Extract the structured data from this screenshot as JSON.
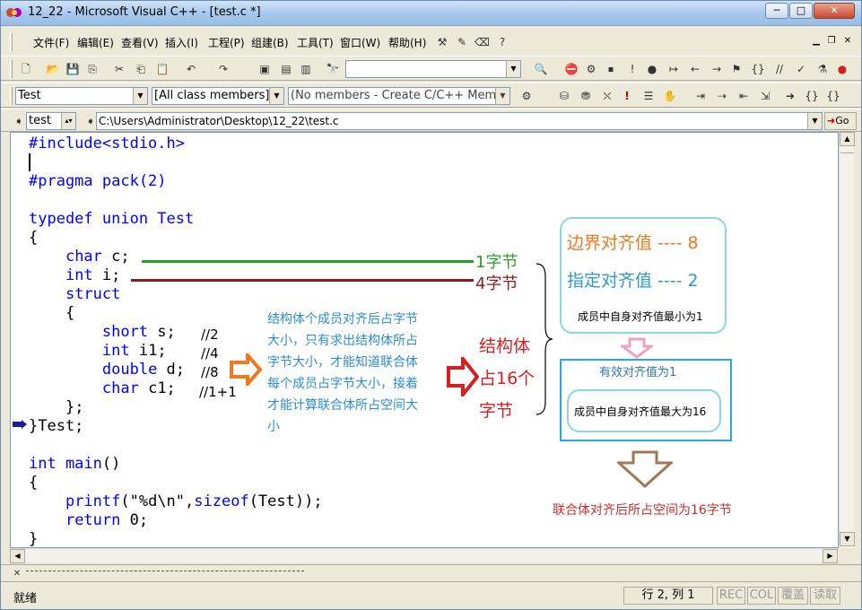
{
  "window": {
    "title": "12_22 - Microsoft Visual C++ - [test.c *]",
    "min": "─",
    "max": "□",
    "close": "✕"
  },
  "menu": [
    "文件(F)",
    "编辑(E)",
    "查看(V)",
    "插入(I)",
    "工程(P)",
    "组建(B)",
    "工具(T)",
    "窗口(W)",
    "帮助(H)"
  ],
  "toolbar_class": {
    "project": "Test",
    "classes": "[All class members]",
    "members": "(No members - Create C/C++ Memb"
  },
  "toolbar_path": {
    "file": "test",
    "path": "C:\\Users\\Administrator\\Desktop\\12_22\\test.c",
    "go": "Go"
  },
  "code": {
    "l1": "#include<stdio.h>",
    "l3": "#pragma pack(2)",
    "l5_kw": "typedef union",
    "l5_name": " Test",
    "l6": "{",
    "l7_kw": "char",
    "l7_rest": " c;",
    "l8_kw": "int",
    "l8_rest": " i;",
    "l9": "struct",
    "l10": "{",
    "l11_kw": "short",
    "l11_rest": " s;",
    "l11_c": "//2",
    "l12_kw": "int",
    "l12_rest": " i1;",
    "l12_c": "//4",
    "l13_kw": "double",
    "l13_rest": " d;",
    "l13_c": "//8",
    "l14_kw": "char",
    "l14_rest": " c1;",
    "l14_c": "//1+1",
    "l15": "};",
    "l16": "}Test;",
    "l18_kw": "int main",
    "l18_rest": "()",
    "l19": "{",
    "l20_kw": "printf",
    "l20_mid": "(\"%d\\n\",",
    "l20_kw2": "sizeof",
    "l20_end": "(Test));",
    "l21_kw": "return",
    "l21_rest": " 0;",
    "l22": "}"
  },
  "annotations": {
    "one_byte": "1字节",
    "four_byte": "4字节",
    "struct_desc": [
      "结构体个成员对齐后占字节",
      "大小，只有求出结构体所占",
      "字节大小，才能知道联合体",
      "每个成员占字节大小，接着",
      "才能计算联合体所占空间大",
      "小"
    ],
    "struct_size": [
      "结构体",
      "占16个",
      "字节"
    ],
    "boundary": "边界对齐值 ---- 8",
    "specified": "指定对齐值 ---- 2",
    "member_min": "成员中自身对齐值最小为1",
    "effective": "有效对齐值为1",
    "member_max": "成员中自身对齐值最大为16",
    "result": "联合体对齐后所占空间为16字节"
  },
  "status": {
    "ready": "就绪",
    "pos": "行 2, 列 1",
    "rec": "REC",
    "col": "COL",
    "ovr": "覆盖",
    "read": "读取"
  },
  "colors": {
    "orange": "#f07820",
    "red": "#d42020",
    "darkred": "#8b1a1a",
    "green": "#2aa02a",
    "teal": "#2a9ad0",
    "cyanbox": "#2aa8d8"
  }
}
